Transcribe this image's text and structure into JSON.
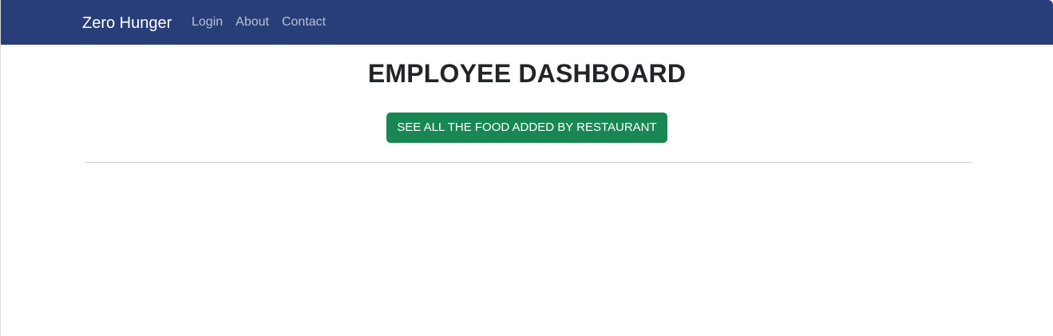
{
  "navbar": {
    "brand": "Zero Hunger",
    "links": [
      {
        "label": "Login"
      },
      {
        "label": "About"
      },
      {
        "label": "Contact"
      }
    ],
    "background_color": "#283e78"
  },
  "main": {
    "title": "EMPLOYEE DASHBOARD",
    "food_button_label": "SEE ALL THE FOOD ADDED BY RESTAURANT",
    "button_color": "#198754"
  }
}
